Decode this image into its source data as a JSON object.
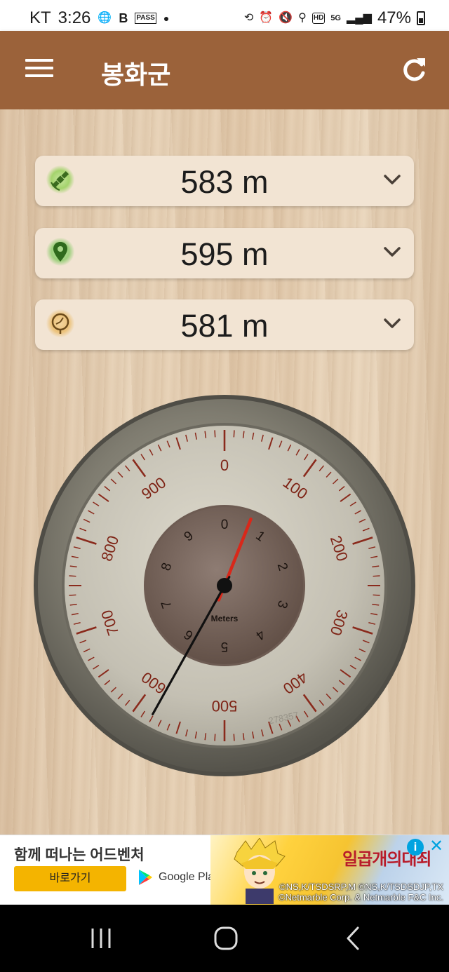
{
  "status_bar": {
    "carrier": "KT",
    "time": "3:26",
    "battery": "47%",
    "network": "5G",
    "hd_label": "HD",
    "pass_label": "PASS",
    "b_label": "B"
  },
  "app_bar": {
    "title": "봉화군",
    "menu_icon": "hamburger-menu-icon",
    "refresh_icon": "refresh-icon"
  },
  "readings": [
    {
      "source": "gps-satellite",
      "icon": "satellite-icon",
      "icon_color": "#8bc34a",
      "value": "583 m"
    },
    {
      "source": "location",
      "icon": "map-pin-icon",
      "icon_color": "#4f8f2a",
      "value": "595 m"
    },
    {
      "source": "barometer",
      "icon": "barometer-icon",
      "icon_color": "#e6b56a",
      "value": "581 m"
    }
  ],
  "altimeter": {
    "outer_scale_labels": [
      "0",
      "100",
      "200",
      "300",
      "400",
      "500",
      "600",
      "700",
      "800",
      "900"
    ],
    "inner_scale_labels": [
      "0",
      "1",
      "2",
      "3",
      "4",
      "5",
      "6",
      "7",
      "8",
      "9"
    ],
    "unit_label": "Meters",
    "serial": "278357",
    "long_hand_value_m": 581,
    "short_hand_value_km": 0.6,
    "needle_colors": {
      "long": "#111111",
      "short": "#d8281a"
    }
  },
  "ad": {
    "headline": "함께 떠나는 어드벤처",
    "cta": "바로가기",
    "store": "Google Play",
    "game_title": "일곱개의대죄",
    "copyright_line1": "©NS,K/TSDSRP,M ©NS,K/TSDSDJP,TX",
    "copyright_line2": "©Netmarble Corp. & Netmarble F&C Inc.",
    "info_glyph": "i",
    "close_glyph": "✕"
  },
  "nav_bar": {
    "recents": "recent-apps-icon",
    "home": "home-icon",
    "back": "back-icon"
  }
}
